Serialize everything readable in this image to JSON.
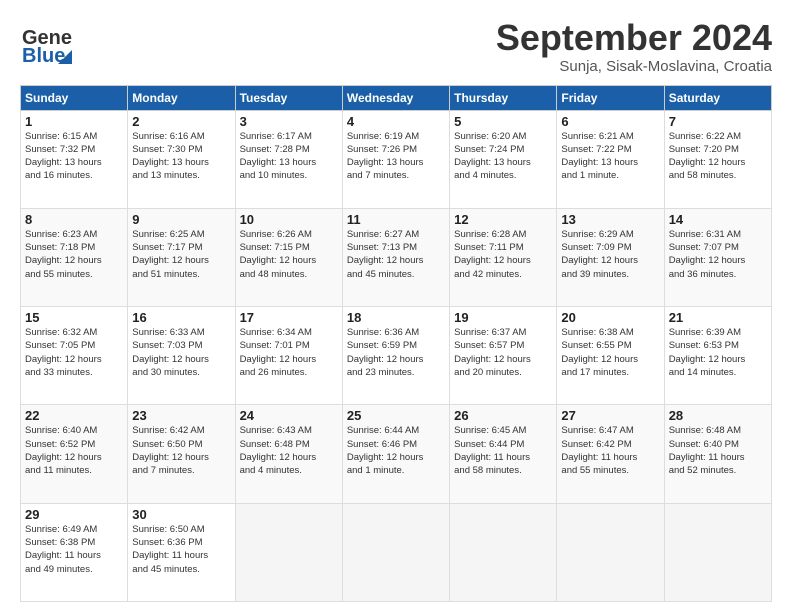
{
  "header": {
    "logo_line1": "General",
    "logo_line2": "Blue",
    "month": "September 2024",
    "location": "Sunja, Sisak-Moslavina, Croatia"
  },
  "weekdays": [
    "Sunday",
    "Monday",
    "Tuesday",
    "Wednesday",
    "Thursday",
    "Friday",
    "Saturday"
  ],
  "weeks": [
    [
      {
        "day": "1",
        "info": "Sunrise: 6:15 AM\nSunset: 7:32 PM\nDaylight: 13 hours\nand 16 minutes."
      },
      {
        "day": "2",
        "info": "Sunrise: 6:16 AM\nSunset: 7:30 PM\nDaylight: 13 hours\nand 13 minutes."
      },
      {
        "day": "3",
        "info": "Sunrise: 6:17 AM\nSunset: 7:28 PM\nDaylight: 13 hours\nand 10 minutes."
      },
      {
        "day": "4",
        "info": "Sunrise: 6:19 AM\nSunset: 7:26 PM\nDaylight: 13 hours\nand 7 minutes."
      },
      {
        "day": "5",
        "info": "Sunrise: 6:20 AM\nSunset: 7:24 PM\nDaylight: 13 hours\nand 4 minutes."
      },
      {
        "day": "6",
        "info": "Sunrise: 6:21 AM\nSunset: 7:22 PM\nDaylight: 13 hours\nand 1 minute."
      },
      {
        "day": "7",
        "info": "Sunrise: 6:22 AM\nSunset: 7:20 PM\nDaylight: 12 hours\nand 58 minutes."
      }
    ],
    [
      {
        "day": "8",
        "info": "Sunrise: 6:23 AM\nSunset: 7:18 PM\nDaylight: 12 hours\nand 55 minutes."
      },
      {
        "day": "9",
        "info": "Sunrise: 6:25 AM\nSunset: 7:17 PM\nDaylight: 12 hours\nand 51 minutes."
      },
      {
        "day": "10",
        "info": "Sunrise: 6:26 AM\nSunset: 7:15 PM\nDaylight: 12 hours\nand 48 minutes."
      },
      {
        "day": "11",
        "info": "Sunrise: 6:27 AM\nSunset: 7:13 PM\nDaylight: 12 hours\nand 45 minutes."
      },
      {
        "day": "12",
        "info": "Sunrise: 6:28 AM\nSunset: 7:11 PM\nDaylight: 12 hours\nand 42 minutes."
      },
      {
        "day": "13",
        "info": "Sunrise: 6:29 AM\nSunset: 7:09 PM\nDaylight: 12 hours\nand 39 minutes."
      },
      {
        "day": "14",
        "info": "Sunrise: 6:31 AM\nSunset: 7:07 PM\nDaylight: 12 hours\nand 36 minutes."
      }
    ],
    [
      {
        "day": "15",
        "info": "Sunrise: 6:32 AM\nSunset: 7:05 PM\nDaylight: 12 hours\nand 33 minutes."
      },
      {
        "day": "16",
        "info": "Sunrise: 6:33 AM\nSunset: 7:03 PM\nDaylight: 12 hours\nand 30 minutes."
      },
      {
        "day": "17",
        "info": "Sunrise: 6:34 AM\nSunset: 7:01 PM\nDaylight: 12 hours\nand 26 minutes."
      },
      {
        "day": "18",
        "info": "Sunrise: 6:36 AM\nSunset: 6:59 PM\nDaylight: 12 hours\nand 23 minutes."
      },
      {
        "day": "19",
        "info": "Sunrise: 6:37 AM\nSunset: 6:57 PM\nDaylight: 12 hours\nand 20 minutes."
      },
      {
        "day": "20",
        "info": "Sunrise: 6:38 AM\nSunset: 6:55 PM\nDaylight: 12 hours\nand 17 minutes."
      },
      {
        "day": "21",
        "info": "Sunrise: 6:39 AM\nSunset: 6:53 PM\nDaylight: 12 hours\nand 14 minutes."
      }
    ],
    [
      {
        "day": "22",
        "info": "Sunrise: 6:40 AM\nSunset: 6:52 PM\nDaylight: 12 hours\nand 11 minutes."
      },
      {
        "day": "23",
        "info": "Sunrise: 6:42 AM\nSunset: 6:50 PM\nDaylight: 12 hours\nand 7 minutes."
      },
      {
        "day": "24",
        "info": "Sunrise: 6:43 AM\nSunset: 6:48 PM\nDaylight: 12 hours\nand 4 minutes."
      },
      {
        "day": "25",
        "info": "Sunrise: 6:44 AM\nSunset: 6:46 PM\nDaylight: 12 hours\nand 1 minute."
      },
      {
        "day": "26",
        "info": "Sunrise: 6:45 AM\nSunset: 6:44 PM\nDaylight: 11 hours\nand 58 minutes."
      },
      {
        "day": "27",
        "info": "Sunrise: 6:47 AM\nSunset: 6:42 PM\nDaylight: 11 hours\nand 55 minutes."
      },
      {
        "day": "28",
        "info": "Sunrise: 6:48 AM\nSunset: 6:40 PM\nDaylight: 11 hours\nand 52 minutes."
      }
    ],
    [
      {
        "day": "29",
        "info": "Sunrise: 6:49 AM\nSunset: 6:38 PM\nDaylight: 11 hours\nand 49 minutes."
      },
      {
        "day": "30",
        "info": "Sunrise: 6:50 AM\nSunset: 6:36 PM\nDaylight: 11 hours\nand 45 minutes."
      },
      {
        "day": "",
        "info": ""
      },
      {
        "day": "",
        "info": ""
      },
      {
        "day": "",
        "info": ""
      },
      {
        "day": "",
        "info": ""
      },
      {
        "day": "",
        "info": ""
      }
    ]
  ]
}
